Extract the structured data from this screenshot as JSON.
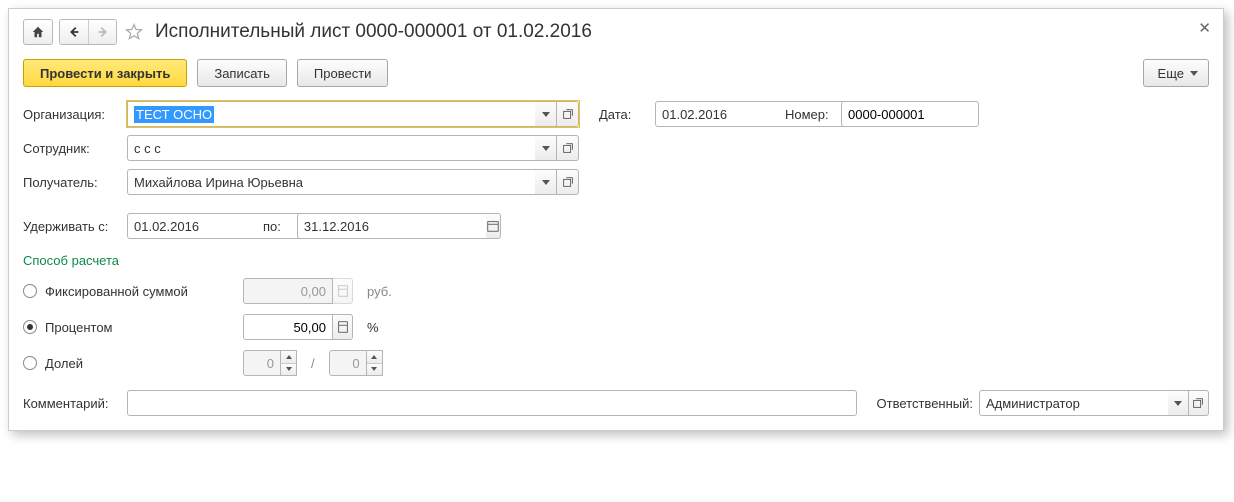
{
  "header": {
    "title": "Исполнительный лист 0000-000001 от 01.02.2016"
  },
  "toolbar": {
    "post_and_close": "Провести и закрыть",
    "save": "Записать",
    "post": "Провести",
    "more": "Еще"
  },
  "labels": {
    "organization": "Организация:",
    "employee": "Сотрудник:",
    "recipient": "Получатель:",
    "date": "Дата:",
    "number": "Номер:",
    "withhold_from": "Удерживать с:",
    "to": "по:",
    "calc_method": "Способ расчета",
    "fixed_amount": "Фиксированной суммой",
    "percent": "Процентом",
    "fraction": "Долей",
    "comment": "Комментарий:",
    "responsible": "Ответственный:",
    "rub": "руб.",
    "pct": "%",
    "slash": "/"
  },
  "values": {
    "organization": "ТЕСТ ОСНО",
    "employee": "с с с",
    "recipient": "Михайлова Ирина Юрьевна",
    "date": "01.02.2016",
    "number": "0000-000001",
    "withhold_from": "01.02.2016",
    "withhold_to": "31.12.2016",
    "fixed_amount": "0,00",
    "percent": "50,00",
    "fraction_num": "0",
    "fraction_den": "0",
    "comment": "",
    "responsible": "Администратор"
  },
  "radio_selected": "percent"
}
